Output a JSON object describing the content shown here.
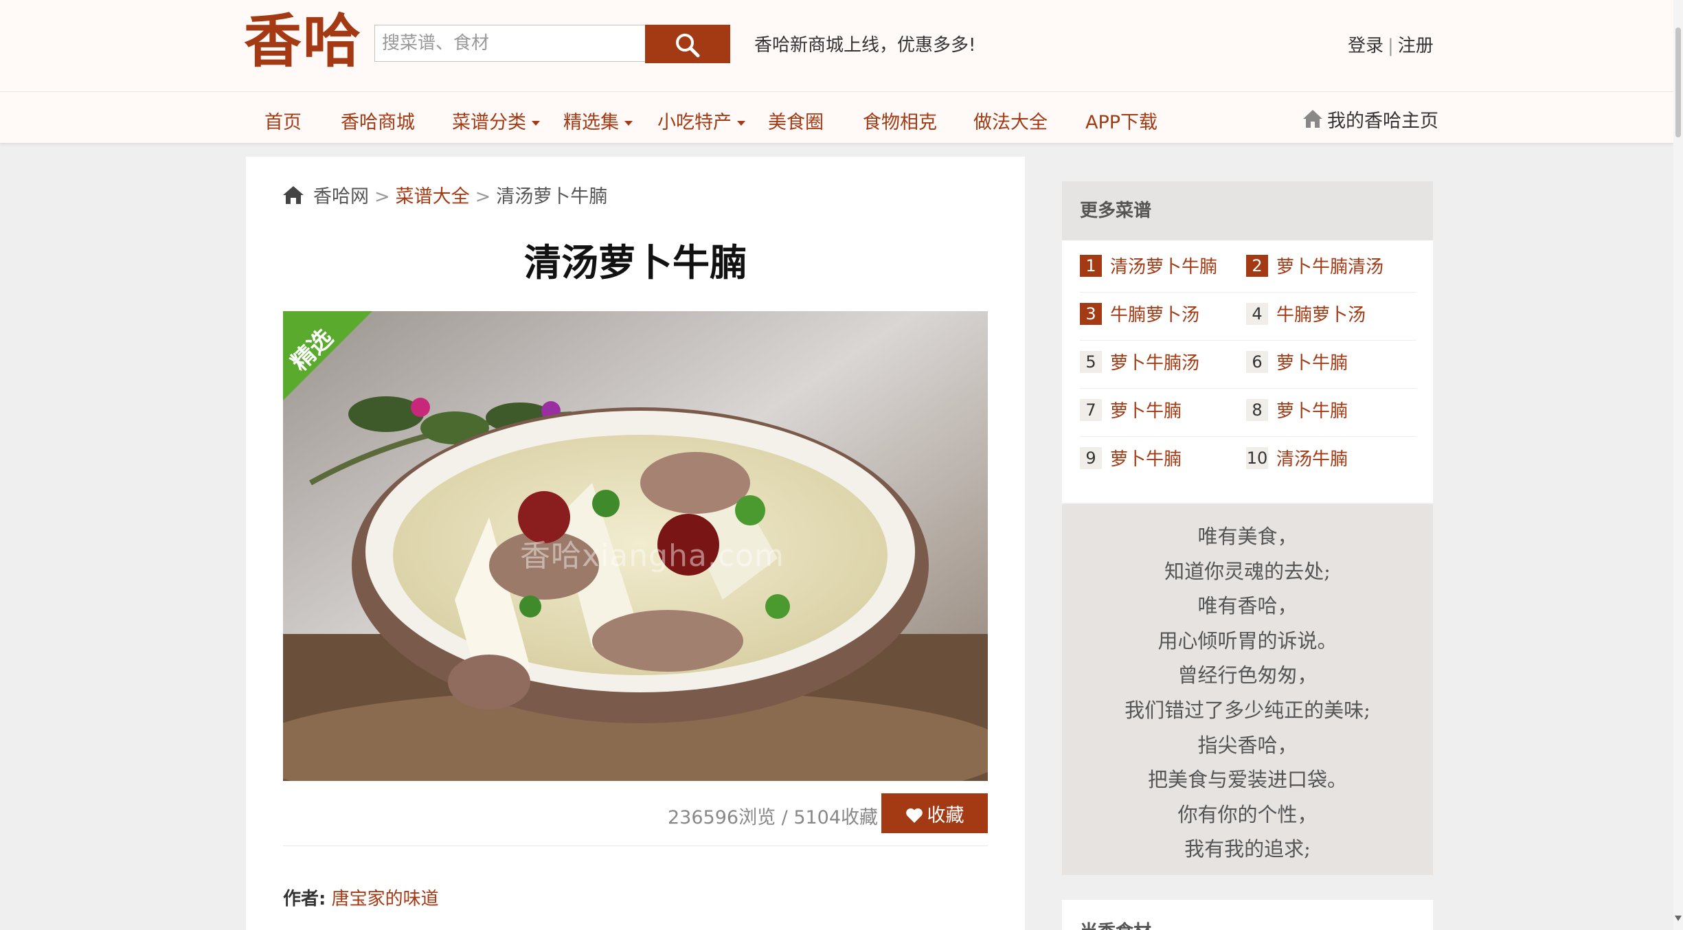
{
  "header": {
    "logo_text": "香哈",
    "search_placeholder": "搜菜谱、食材",
    "notice": "香哈新商城上线，优惠多多!",
    "login": "登录",
    "separator": "|",
    "register": "注册"
  },
  "nav": {
    "items": [
      {
        "label": "首页"
      },
      {
        "label": "香哈商城"
      },
      {
        "label": "菜谱分类"
      },
      {
        "label": "精选集"
      },
      {
        "label": "小吃特产"
      },
      {
        "label": "美食圈"
      },
      {
        "label": "食物相克"
      },
      {
        "label": "做法大全"
      },
      {
        "label": "APP下载"
      }
    ],
    "home_link": "我的香哈主页"
  },
  "breadcrumb": {
    "items": [
      "香哈网",
      "菜谱大全",
      "清汤萝卜牛腩"
    ],
    "separator": ">"
  },
  "recipe": {
    "title": "清汤萝卜牛腩",
    "badge": "精选",
    "watermark": "香哈xiangha.com",
    "stats": "236596浏览 / 5104收藏",
    "favorite_label": "收藏",
    "author_label": "作者:",
    "author_name": "唐宝家的味道"
  },
  "more_recipes": {
    "heading": "更多菜谱",
    "items": [
      {
        "rank": "1",
        "name": "清汤萝卜牛腩"
      },
      {
        "rank": "2",
        "name": "萝卜牛腩清汤"
      },
      {
        "rank": "3",
        "name": "牛腩萝卜汤"
      },
      {
        "rank": "4",
        "name": "牛腩萝卜汤"
      },
      {
        "rank": "5",
        "name": "萝卜牛腩汤"
      },
      {
        "rank": "6",
        "name": "萝卜牛腩"
      },
      {
        "rank": "7",
        "name": "萝卜牛腩"
      },
      {
        "rank": "8",
        "name": "萝卜牛腩"
      },
      {
        "rank": "9",
        "name": "萝卜牛腩"
      },
      {
        "rank": "10",
        "name": "清汤牛腩"
      }
    ]
  },
  "poem": {
    "lines": [
      "唯有美食，",
      "知道你灵魂的去处;",
      "唯有香哈，",
      "用心倾听胃的诉说。",
      "曾经行色匆匆，",
      "我们错过了多少纯正的美味;",
      "指尖香哈，",
      "把美食与爱装进口袋。",
      "你有你的个性，",
      "我有我的追求;"
    ]
  },
  "seasonal": {
    "heading": "当季食材"
  },
  "colors": {
    "brand": "#a33a14",
    "badge_green": "#5aab2d",
    "rank_highlight": "#a33a14"
  }
}
